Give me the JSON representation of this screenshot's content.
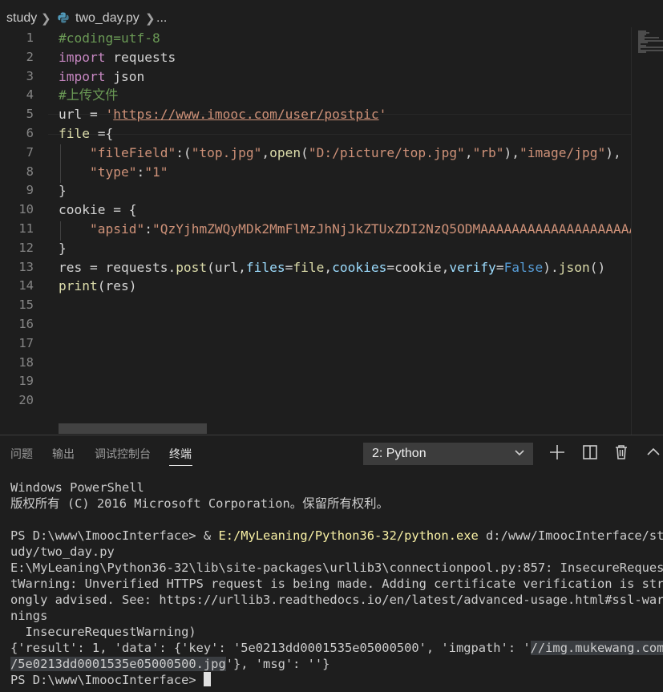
{
  "breadcrumb": {
    "folder": "study",
    "file": "two_day.py",
    "symbol": "..."
  },
  "editor": {
    "line_numbers": [
      "1",
      "2",
      "3",
      "4",
      "5",
      "6",
      "7",
      "8",
      "9",
      "10",
      "11",
      "12",
      "13",
      "14",
      "15",
      "16",
      "17",
      "18",
      "19",
      "20"
    ],
    "lines": [
      [
        {
          "t": "#coding=utf-8",
          "c": "c-comment"
        }
      ],
      [
        {
          "t": "import",
          "c": "c-kw"
        },
        {
          "t": " requests",
          "c": ""
        }
      ],
      [
        {
          "t": "import",
          "c": "c-kw"
        },
        {
          "t": " json",
          "c": ""
        }
      ],
      [
        {
          "t": "#上传文件",
          "c": "c-comment"
        }
      ],
      [
        {
          "t": "url = ",
          "c": ""
        },
        {
          "t": "'",
          "c": "c-str"
        },
        {
          "t": "https://www.imooc.com/user/postpic",
          "c": "c-str-u"
        },
        {
          "t": "'",
          "c": "c-str"
        }
      ],
      [
        {
          "t": "file",
          "c": "c-fn"
        },
        {
          "t": " ={",
          "c": ""
        }
      ],
      [
        {
          "t": "    ",
          "c": ""
        },
        {
          "t": "\"fileField\"",
          "c": "c-str"
        },
        {
          "t": ":(",
          "c": ""
        },
        {
          "t": "\"top.jpg\"",
          "c": "c-str"
        },
        {
          "t": ",",
          "c": ""
        },
        {
          "t": "open",
          "c": "c-fn"
        },
        {
          "t": "(",
          "c": ""
        },
        {
          "t": "\"D:/picture/top.jpg\"",
          "c": "c-str"
        },
        {
          "t": ",",
          "c": ""
        },
        {
          "t": "\"rb\"",
          "c": "c-str"
        },
        {
          "t": "),",
          "c": ""
        },
        {
          "t": "\"image/jpg\"",
          "c": "c-str"
        },
        {
          "t": "),",
          "c": ""
        }
      ],
      [
        {
          "t": "    ",
          "c": ""
        },
        {
          "t": "\"type\"",
          "c": "c-str"
        },
        {
          "t": ":",
          "c": ""
        },
        {
          "t": "\"1\"",
          "c": "c-str"
        }
      ],
      [
        {
          "t": "}",
          "c": ""
        }
      ],
      [
        {
          "t": "cookie = {",
          "c": ""
        }
      ],
      [
        {
          "t": "    ",
          "c": ""
        },
        {
          "t": "\"apsid\"",
          "c": "c-str"
        },
        {
          "t": ":",
          "c": ""
        },
        {
          "t": "\"QzYjhmZWQyMDk2MmFlMzJhNjJkZTUxZDI2NzQ5ODMAAAAAAAAAAAAAAAAAAAAA",
          "c": "c-str"
        }
      ],
      [
        {
          "t": "}",
          "c": ""
        }
      ],
      [
        {
          "t": "res = requests.",
          "c": ""
        },
        {
          "t": "post",
          "c": "c-fn"
        },
        {
          "t": "(url,",
          "c": ""
        },
        {
          "t": "files",
          "c": "c-var"
        },
        {
          "t": "=",
          "c": ""
        },
        {
          "t": "file",
          "c": "c-fn"
        },
        {
          "t": ",",
          "c": ""
        },
        {
          "t": "cookies",
          "c": "c-var"
        },
        {
          "t": "=cookie,",
          "c": ""
        },
        {
          "t": "verify",
          "c": "c-var"
        },
        {
          "t": "=",
          "c": ""
        },
        {
          "t": "False",
          "c": "c-const"
        },
        {
          "t": ").",
          "c": ""
        },
        {
          "t": "json",
          "c": "c-fn"
        },
        {
          "t": "()",
          "c": ""
        }
      ],
      [
        {
          "t": "print",
          "c": "c-fn"
        },
        {
          "t": "(res)",
          "c": ""
        }
      ],
      [],
      [],
      [],
      [],
      [],
      []
    ]
  },
  "panel": {
    "tabs": [
      "问题",
      "输出",
      "调试控制台",
      "终端"
    ],
    "active_tab": "终端",
    "terminal_select": "2: Python",
    "icons": [
      "plus-icon",
      "split-icon",
      "trash-icon",
      "chevron-up-icon"
    ]
  },
  "terminal": {
    "lines": [
      [
        {
          "t": "Windows PowerShell",
          "c": ""
        }
      ],
      [
        {
          "t": "版权所有 (C) 2016 Microsoft Corporation。保留所有权利。",
          "c": ""
        }
      ],
      [],
      [
        {
          "t": "PS D:\\www\\ImoocInterface> & ",
          "c": ""
        },
        {
          "t": "E:/MyLeaning/Python36-32/python.exe",
          "c": "t-yellow"
        },
        {
          "t": " d:/www/ImoocInterface/st",
          "c": ""
        }
      ],
      [
        {
          "t": "udy/two_day.py",
          "c": ""
        }
      ],
      [
        {
          "t": "E:\\MyLeaning\\Python36-32\\lib\\site-packages\\urllib3\\connectionpool.py:857: InsecureReques",
          "c": ""
        }
      ],
      [
        {
          "t": "tWarning: Unverified HTTPS request is being made. Adding certificate verification is str",
          "c": ""
        }
      ],
      [
        {
          "t": "ongly advised. See: https://urllib3.readthedocs.io/en/latest/advanced-usage.html#ssl-war",
          "c": ""
        }
      ],
      [
        {
          "t": "nings",
          "c": ""
        }
      ],
      [
        {
          "t": "  InsecureRequestWarning)",
          "c": ""
        }
      ],
      [
        {
          "t": "{'result': 1, 'data': {'key': '5e0213dd0001535e05000500', 'imgpath': '",
          "c": ""
        },
        {
          "t": "//img.mukewang.com",
          "c": "t-sel"
        }
      ],
      [
        {
          "t": "/5e0213dd0001535e05000500.jpg",
          "c": "t-sel"
        },
        {
          "t": "'}, 'msg': ''}",
          "c": ""
        }
      ],
      [
        {
          "t": "PS D:\\www\\ImoocInterface> ",
          "c": ""
        }
      ]
    ]
  }
}
